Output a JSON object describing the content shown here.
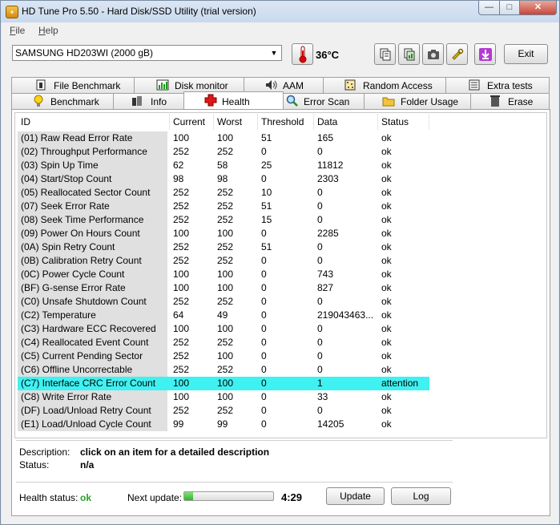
{
  "window": {
    "title": "HD Tune Pro 5.50 - Hard Disk/SSD Utility (trial version)",
    "min_glyph": "—",
    "max_glyph": "□",
    "close_glyph": "✕"
  },
  "menu": {
    "file": "File",
    "help": "Help"
  },
  "toolbar": {
    "drive": "SAMSUNG HD203WI (2000 gB)",
    "temperature": "36°C",
    "exit_label": "Exit"
  },
  "tabs": {
    "top": [
      "File Benchmark",
      "Disk monitor",
      "AAM",
      "Random Access",
      "Extra tests"
    ],
    "bottom": [
      "Benchmark",
      "Info",
      "Health",
      "Error Scan",
      "Folder Usage",
      "Erase"
    ],
    "active": "Health"
  },
  "table": {
    "headers": [
      "ID",
      "Current",
      "Worst",
      "Threshold",
      "Data",
      "Status"
    ],
    "rows": [
      [
        "(01) Raw Read Error Rate",
        "100",
        "100",
        "51",
        "165",
        "ok"
      ],
      [
        "(02) Throughput Performance",
        "252",
        "252",
        "0",
        "0",
        "ok"
      ],
      [
        "(03) Spin Up Time",
        "62",
        "58",
        "25",
        "11812",
        "ok"
      ],
      [
        "(04) Start/Stop Count",
        "98",
        "98",
        "0",
        "2303",
        "ok"
      ],
      [
        "(05) Reallocated Sector Count",
        "252",
        "252",
        "10",
        "0",
        "ok"
      ],
      [
        "(07) Seek Error Rate",
        "252",
        "252",
        "51",
        "0",
        "ok"
      ],
      [
        "(08) Seek Time Performance",
        "252",
        "252",
        "15",
        "0",
        "ok"
      ],
      [
        "(09) Power On Hours Count",
        "100",
        "100",
        "0",
        "2285",
        "ok"
      ],
      [
        "(0A) Spin Retry Count",
        "252",
        "252",
        "51",
        "0",
        "ok"
      ],
      [
        "(0B) Calibration Retry Count",
        "252",
        "252",
        "0",
        "0",
        "ok"
      ],
      [
        "(0C) Power Cycle Count",
        "100",
        "100",
        "0",
        "743",
        "ok"
      ],
      [
        "(BF) G-sense Error Rate",
        "100",
        "100",
        "0",
        "827",
        "ok"
      ],
      [
        "(C0) Unsafe Shutdown Count",
        "252",
        "252",
        "0",
        "0",
        "ok"
      ],
      [
        "(C2) Temperature",
        "64",
        "49",
        "0",
        "219043463...",
        "ok"
      ],
      [
        "(C3) Hardware ECC Recovered",
        "100",
        "100",
        "0",
        "0",
        "ok"
      ],
      [
        "(C4) Reallocated Event Count",
        "252",
        "252",
        "0",
        "0",
        "ok"
      ],
      [
        "(C5) Current Pending Sector",
        "252",
        "100",
        "0",
        "0",
        "ok"
      ],
      [
        "(C6) Offline Uncorrectable",
        "252",
        "252",
        "0",
        "0",
        "ok"
      ],
      [
        "(C7) Interface CRC Error Count",
        "100",
        "100",
        "0",
        "1",
        "attention"
      ],
      [
        "(C8) Write Error Rate",
        "100",
        "100",
        "0",
        "33",
        "ok"
      ],
      [
        "(DF) Load/Unload Retry Count",
        "252",
        "252",
        "0",
        "0",
        "ok"
      ],
      [
        "(E1) Load/Unload Cycle Count",
        "99",
        "99",
        "0",
        "14205",
        "ok"
      ]
    ],
    "highlight_color": "#3ff1f1"
  },
  "details": {
    "description_label": "Description:",
    "description_value": "click on an item for a detailed description",
    "status_label": "Status:",
    "status_value": "n/a"
  },
  "footer": {
    "health_label": "Health status:",
    "health_value": "ok",
    "next_update_label": "Next update:",
    "progress_fraction": 0.1,
    "countdown": "4:29",
    "update_label": "Update",
    "log_label": "Log"
  }
}
